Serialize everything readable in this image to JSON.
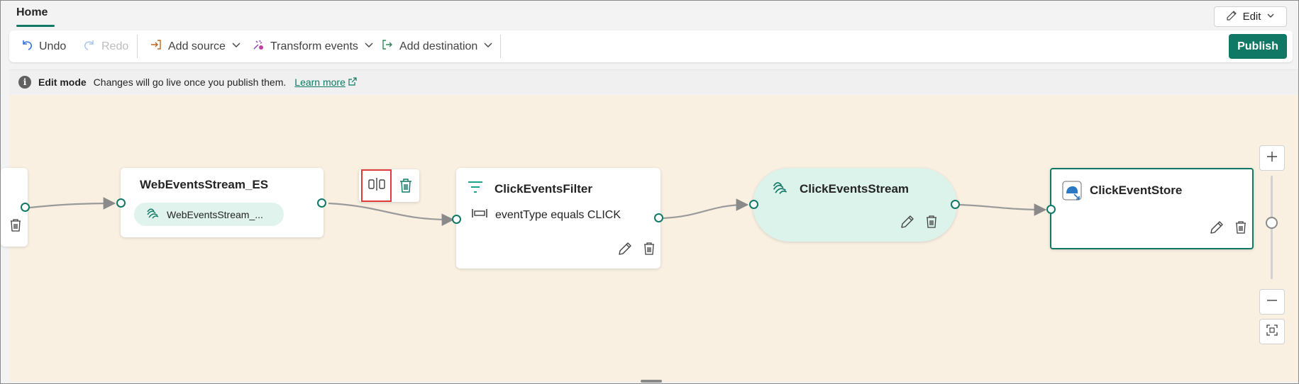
{
  "tabs": {
    "home": "Home"
  },
  "edit_button": {
    "label": "Edit"
  },
  "toolbar": {
    "undo": "Undo",
    "redo": "Redo",
    "add_source": "Add source",
    "transform_events": "Transform events",
    "add_destination": "Add destination",
    "publish": "Publish"
  },
  "infobar": {
    "mode": "Edit mode",
    "message": "Changes will go live once you publish them.",
    "link": "Learn more"
  },
  "nodes": {
    "source": {
      "title": "WebEventsStream_ES",
      "pill": "WebEventsStream_..."
    },
    "filter": {
      "title": "ClickEventsFilter",
      "condition": "eventType equals CLICK"
    },
    "stream": {
      "title": "ClickEventsStream"
    },
    "destination": {
      "title": "ClickEventStore"
    }
  },
  "colors": {
    "accent": "#117865",
    "canvas": "#f9f0e2",
    "stream_fill": "#dcf3ec",
    "highlight": "#e03a3a"
  }
}
